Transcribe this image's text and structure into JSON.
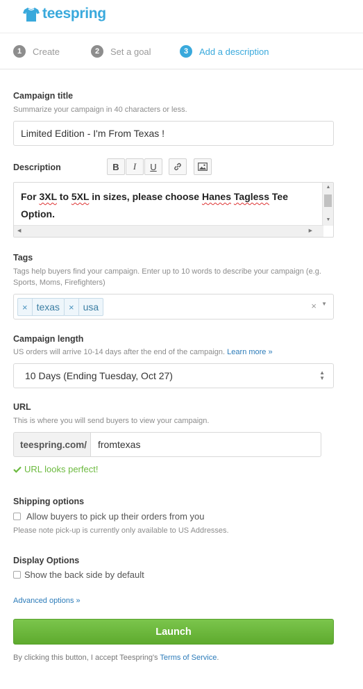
{
  "brand": {
    "name": "teespring",
    "color": "#39a9dc"
  },
  "steps": [
    {
      "num": "1",
      "label": "Create",
      "active": false
    },
    {
      "num": "2",
      "label": "Set a goal",
      "active": false
    },
    {
      "num": "3",
      "label": "Add a description",
      "active": true
    }
  ],
  "campaign_title": {
    "label": "Campaign title",
    "hint": "Summarize your campaign in 40 characters or less.",
    "value": "Limited Edition - I'm From Texas !"
  },
  "description": {
    "label": "Description",
    "toolbar": {
      "bold": "B",
      "italic": "I",
      "underline": "U",
      "link_icon": "link-icon",
      "image_icon": "image-icon"
    },
    "text_parts": [
      "For ",
      "3XL",
      " to ",
      "5XL",
      " in sizes, please choose ",
      "Hanes",
      " ",
      "Tagless",
      " Tee Option."
    ]
  },
  "tags": {
    "label": "Tags",
    "hint": "Tags help buyers find your campaign. Enter up to 10 words to describe your campaign (e.g. Sports, Moms, Firefighters)",
    "items": [
      "texas",
      "usa"
    ],
    "remove_glyph": "×",
    "clear_glyph": "×"
  },
  "campaign_length": {
    "label": "Campaign length",
    "hint": "US orders will arrive 10-14 days after the end of the campaign.",
    "learn_more": "Learn more »",
    "selected": "10 Days (Ending Tuesday, Oct 27)"
  },
  "url": {
    "label": "URL",
    "hint": "This is where you will send buyers to view your campaign.",
    "prefix": "teespring.com/",
    "value": "fromtexas",
    "status": "URL looks perfect!",
    "status_color": "#6cba3f"
  },
  "shipping": {
    "label": "Shipping options",
    "checkbox_label": "Allow buyers to pick up their orders from you",
    "checked": false,
    "note": "Please note pick-up is currently only available to US Addresses."
  },
  "display": {
    "label": "Display Options",
    "checkbox_label": "Show the back side by default",
    "checked": false
  },
  "advanced_link": "Advanced options »",
  "launch": {
    "label": "Launch",
    "color": "#6bb83c"
  },
  "tos": {
    "prefix": "By clicking this button, I accept Teespring's ",
    "link": "Terms of Service",
    "suffix": "."
  }
}
